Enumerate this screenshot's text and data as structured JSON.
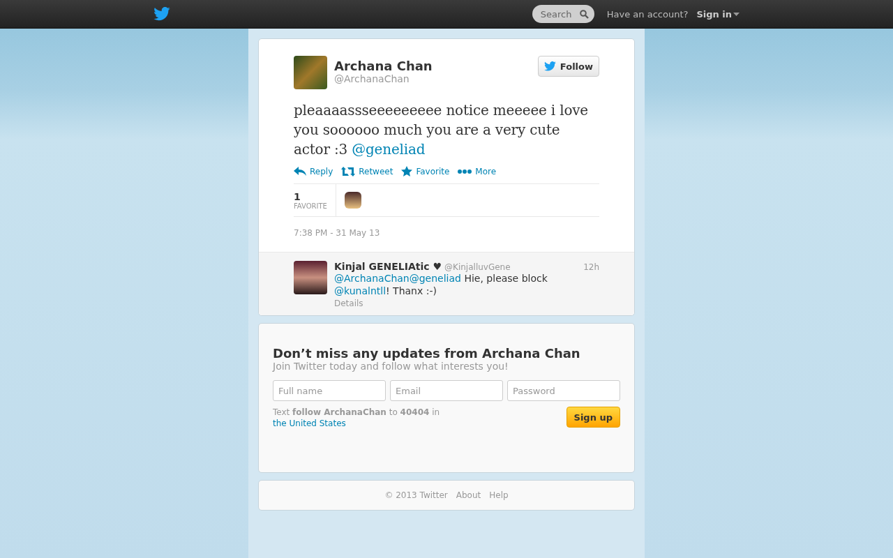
{
  "topbar": {
    "search": {
      "placeholder": "Search"
    },
    "account_prompt": "Have an account?",
    "sign_in": "Sign in"
  },
  "tweet": {
    "name": "Archana Chan",
    "handle": "@ArchanaChan",
    "follow": "Follow",
    "text": "pleaaaassseeeeeeeee notice meeeee i love you soooooo much you are a very cute actor :3 ",
    "link": "@geneliad",
    "actions": [
      {
        "kind": "reply",
        "label": "Reply"
      },
      {
        "kind": "retweet",
        "label": "Retweet"
      },
      {
        "kind": "favorite",
        "label": "Favorite"
      },
      {
        "kind": "more",
        "label": "More"
      }
    ],
    "stats": {
      "count": "1",
      "label": "FAVORITE"
    },
    "timestamp": "7:38 PM - 31 May 13"
  },
  "replies": [
    {
      "name": "Kinjal GENELIAtic ♥",
      "handle": "@KinjalluvGene",
      "time": "12h",
      "details": "Details",
      "parts": [
        {
          "kind": "link",
          "text": "@ArchanaChan"
        },
        {
          "kind": "link",
          "text": "@geneliad"
        },
        {
          "kind": "text",
          "text": " Hie, please block "
        },
        {
          "kind": "link",
          "text": "@kunalntll"
        },
        {
          "kind": "text",
          "text": "! Thanx :-)"
        }
      ]
    }
  ],
  "signup": {
    "title": "Don’t miss any updates from Archana Chan",
    "subtitle": "Join Twitter today and follow what interests you!",
    "fields": [
      {
        "placeholder": "Full name"
      },
      {
        "placeholder": "Email"
      },
      {
        "placeholder": "Password"
      }
    ],
    "sms": "Text **follow ArchanaChan**  to **40404** in ",
    "sms_link": "the United States",
    "button": "Sign up"
  },
  "footer": [
    "© 2013 Twitter",
    "About",
    "Help"
  ]
}
